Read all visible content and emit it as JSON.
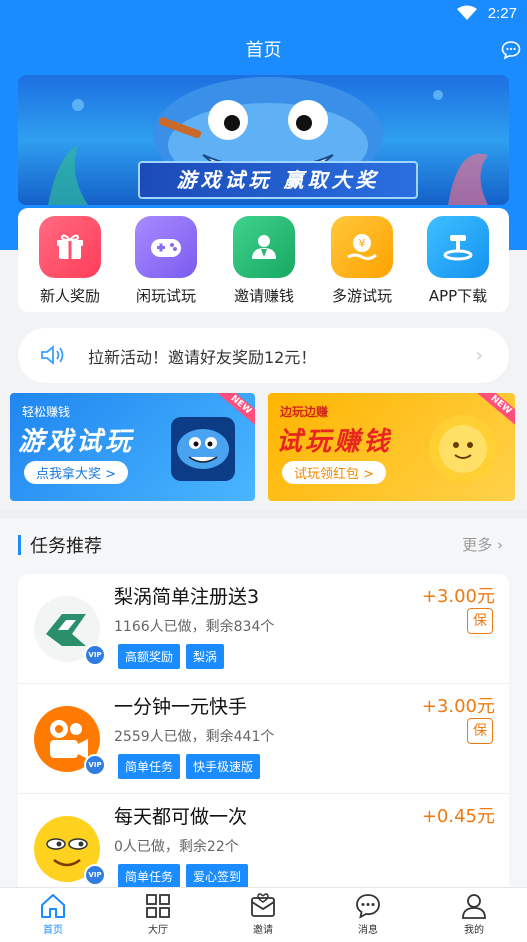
{
  "status": {
    "time": "2:27"
  },
  "nav": {
    "title": "首页"
  },
  "banner": {
    "text": "游戏试玩 赢取大奖"
  },
  "grid": [
    {
      "label": "新人奖励",
      "icon": "gift-icon",
      "color": "#ff4d6a"
    },
    {
      "label": "闲玩试玩",
      "icon": "gamepad-icon",
      "color": "#8a6cf0"
    },
    {
      "label": "邀请赚钱",
      "icon": "user-invite-icon",
      "color": "#22b573"
    },
    {
      "label": "多游试玩",
      "icon": "coin-hand-icon",
      "color": "#ffb400"
    },
    {
      "label": "APP下载",
      "icon": "download-icon",
      "color": "#1aa3ff"
    }
  ],
  "notice": {
    "text": "拉新活动！邀请好友奖励12元！"
  },
  "promos": [
    {
      "small": "轻松赚钱",
      "big": "游戏试玩",
      "button": "点我拿大奖 >",
      "tag": "NEW"
    },
    {
      "small": "边玩边赚",
      "big": "试玩赚钱",
      "button": "试玩领红包 >",
      "tag": "NEW"
    }
  ],
  "section": {
    "title": "任务推荐",
    "more": "更多"
  },
  "tasks": [
    {
      "name": "梨涡简单注册送3",
      "meta": "1166人已做，剩余834个",
      "reward": "+3.00元",
      "bao": "保",
      "tags": [
        "高额奖励",
        "梨涡"
      ]
    },
    {
      "name": "一分钟一元快手",
      "meta": "2559人已做，剩余441个",
      "reward": "+3.00元",
      "bao": "保",
      "tags": [
        "简单任务",
        "快手极速版"
      ]
    },
    {
      "name": "每天都可做一次",
      "meta": "0人已做，剩余22个",
      "reward": "+0.45元",
      "tags": [
        "简单任务",
        "爱心签到"
      ]
    }
  ],
  "vip_badge": "VIP",
  "tabs": [
    {
      "label": "首页",
      "icon": "home-icon"
    },
    {
      "label": "大厅",
      "icon": "grid-icon"
    },
    {
      "label": "邀请",
      "icon": "invite-icon"
    },
    {
      "label": "消息",
      "icon": "message-icon"
    },
    {
      "label": "我的",
      "icon": "profile-icon"
    }
  ]
}
